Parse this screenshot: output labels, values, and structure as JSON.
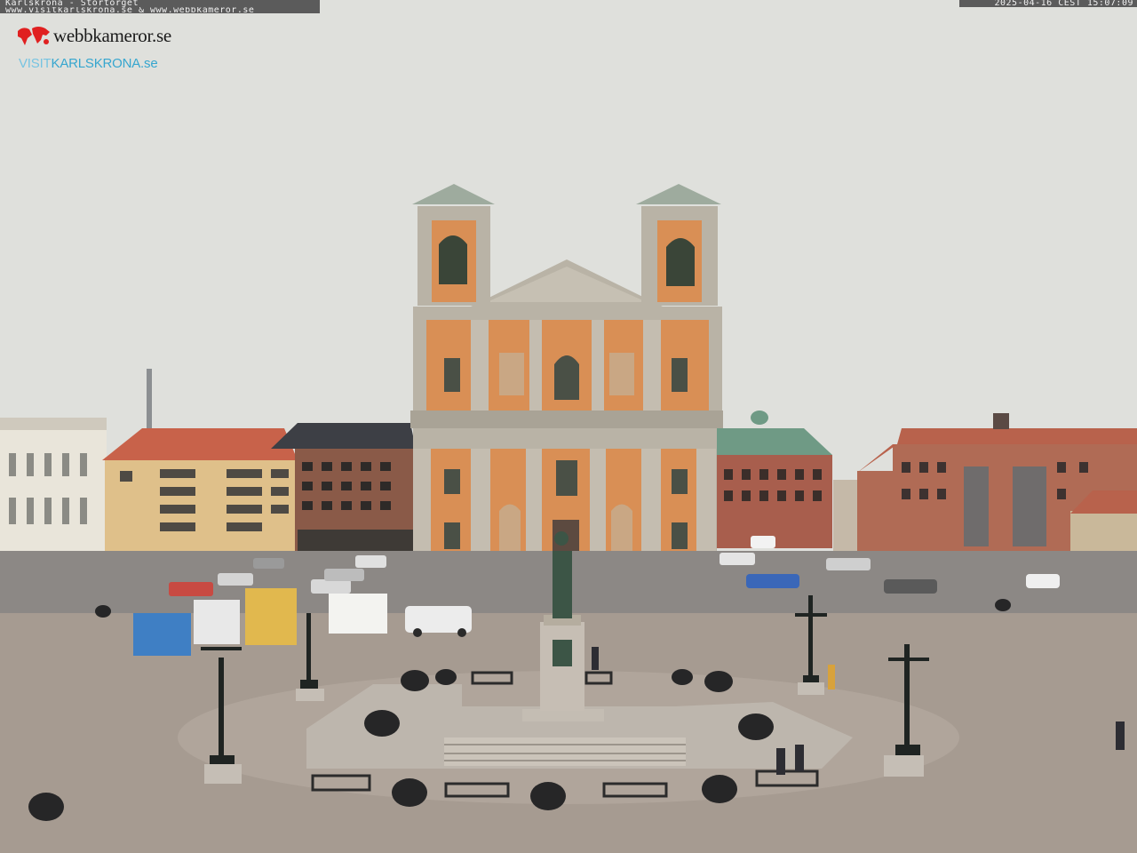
{
  "overlay": {
    "caption_line1": "Karlskrona - Stortorget",
    "caption_line2": "www.visitkarlskrona.se & www.webbkameror.se",
    "timestamp": "2025-04-16 CEST 15:07:09"
  },
  "logos": {
    "webbkameror": "webbkameror.se",
    "visit_prefix": "VISIT",
    "visit_main": "KARLSKRONA.se"
  },
  "colors": {
    "sky": "#dfe0dc",
    "church_facade": "#d98f55",
    "stone": "#b9b3a6",
    "square": "#a69b91",
    "red_roof": "#c8624a",
    "green_roof": "#6f9a85",
    "logo_blue": "#36a6cf"
  }
}
